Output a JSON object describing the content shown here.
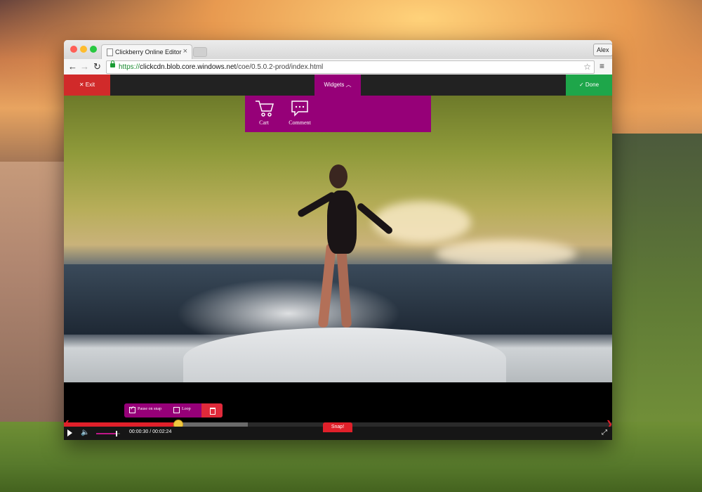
{
  "browser": {
    "tab_title": "Clickberry Online Editor",
    "tab_close": "×",
    "profile_name": "Alex",
    "url_scheme": "https://",
    "url_host": "clickcdn.blob.core.windows.net",
    "url_path": "/coe/0.5.0.2-prod/index.html",
    "nav": {
      "back": "←",
      "forward": "→",
      "reload": "↻",
      "star": "☆",
      "menu": "≡"
    }
  },
  "editor": {
    "exit_label": "✕  Exit",
    "done_label": "✓  Done",
    "widgets_label": "Widgets  ︿",
    "widgets": [
      {
        "label": "Cart",
        "icon": "cart-icon"
      },
      {
        "label": "Comment",
        "icon": "comment-icon"
      }
    ]
  },
  "segment": {
    "pause_on_snap_label": "Pause on snap",
    "pause_on_snap_checked": true,
    "loop_label": "Loop",
    "loop_checked": false
  },
  "player": {
    "time_text": "00:00:30 / 00:02:24",
    "played_fraction": 0.208,
    "buffered_fraction": 0.335,
    "volume_fraction": 0.85,
    "snap_label": "Snap!",
    "play_icon": "play-icon",
    "volume_icon": "volume-icon",
    "fullscreen_icon": "fullscreen-icon"
  },
  "colors": {
    "accent_purple": "#960078",
    "exit_red": "#d12a2a",
    "done_green": "#1ea64a",
    "progress_red": "#e0202a"
  }
}
